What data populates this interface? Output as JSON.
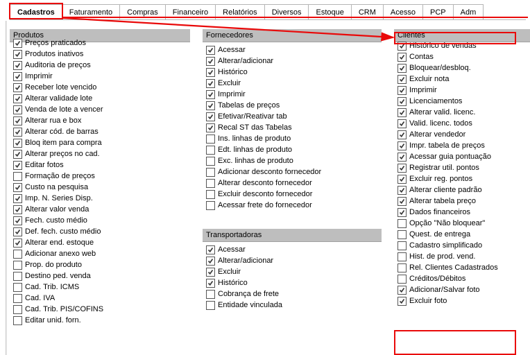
{
  "tabs": {
    "items": [
      {
        "label": "Cadastros",
        "active": true
      },
      {
        "label": "Faturamento",
        "active": false
      },
      {
        "label": "Compras",
        "active": false
      },
      {
        "label": "Financeiro",
        "active": false
      },
      {
        "label": "Relatórios",
        "active": false
      },
      {
        "label": "Diversos",
        "active": false
      },
      {
        "label": "Estoque",
        "active": false
      },
      {
        "label": "CRM",
        "active": false
      },
      {
        "label": "Acesso",
        "active": false
      },
      {
        "label": "PCP",
        "active": false
      },
      {
        "label": "Adm",
        "active": false
      }
    ]
  },
  "sections": {
    "produtos": {
      "title": "Produtos",
      "items": [
        {
          "label": "Preços praticados",
          "checked": true
        },
        {
          "label": "Produtos inativos",
          "checked": true
        },
        {
          "label": "Auditoria de preços",
          "checked": true
        },
        {
          "label": "Imprimir",
          "checked": true
        },
        {
          "label": "Receber lote vencido",
          "checked": true
        },
        {
          "label": "Alterar validade lote",
          "checked": true
        },
        {
          "label": "Venda de lote a vencer",
          "checked": true
        },
        {
          "label": "Alterar rua e box",
          "checked": true
        },
        {
          "label": "Alterar cód. de barras",
          "checked": true
        },
        {
          "label": "Bloq item para compra",
          "checked": true
        },
        {
          "label": "Alterar preços no cad.",
          "checked": true
        },
        {
          "label": "Editar fotos",
          "checked": true
        },
        {
          "label": "Formação de preços",
          "checked": false
        },
        {
          "label": "Custo na pesquisa",
          "checked": true
        },
        {
          "label": "Imp. N. Series Disp.",
          "checked": true
        },
        {
          "label": "Alterar valor venda",
          "checked": true
        },
        {
          "label": "Fech. custo médio",
          "checked": true
        },
        {
          "label": "Def. fech. custo médio",
          "checked": true
        },
        {
          "label": "Alterar end. estoque",
          "checked": true
        },
        {
          "label": "Adicionar anexo web",
          "checked": false
        },
        {
          "label": "Prop. do produto",
          "checked": false
        },
        {
          "label": "Destino ped. venda",
          "checked": false
        },
        {
          "label": "Cad. Trib. ICMS",
          "checked": false
        },
        {
          "label": "Cad. IVA",
          "checked": false
        },
        {
          "label": "Cad. Trib. PIS/COFINS",
          "checked": false
        },
        {
          "label": "Editar unid. forn.",
          "checked": false
        }
      ]
    },
    "fornecedores": {
      "title": "Fornecedores",
      "items": [
        {
          "label": "Acessar",
          "checked": true
        },
        {
          "label": "Alterar/adicionar",
          "checked": true
        },
        {
          "label": "Histórico",
          "checked": true
        },
        {
          "label": "Excluir",
          "checked": true
        },
        {
          "label": "Imprimir",
          "checked": true
        },
        {
          "label": "Tabelas de preços",
          "checked": true
        },
        {
          "label": "Efetivar/Reativar tab",
          "checked": true
        },
        {
          "label": "Recal ST das Tabelas",
          "checked": true
        },
        {
          "label": "Ins. linhas de produto",
          "checked": false
        },
        {
          "label": "Edt. linhas de produto",
          "checked": false
        },
        {
          "label": "Exc. linhas de produto",
          "checked": false
        },
        {
          "label": "Adicionar desconto fornecedor",
          "checked": false
        },
        {
          "label": "Alterar desconto fornecedor",
          "checked": false
        },
        {
          "label": "Excluir desconto fornecedor",
          "checked": false
        },
        {
          "label": "Acessar frete do fornecedor",
          "checked": false
        }
      ]
    },
    "transportadoras": {
      "title": "Transportadoras",
      "items": [
        {
          "label": "Acessar",
          "checked": true
        },
        {
          "label": "Alterar/adicionar",
          "checked": true
        },
        {
          "label": "Excluir",
          "checked": true
        },
        {
          "label": "Histórico",
          "checked": true
        },
        {
          "label": "Cobrança de frete",
          "checked": false
        },
        {
          "label": "Entidade vinculada",
          "checked": false
        }
      ]
    },
    "clientes": {
      "title": "Clientes",
      "items": [
        {
          "label": "Histórico de vendas",
          "checked": true
        },
        {
          "label": "Contas",
          "checked": true
        },
        {
          "label": "Bloquear/desbloq.",
          "checked": true
        },
        {
          "label": "Excluir nota",
          "checked": true
        },
        {
          "label": "Imprimir",
          "checked": true
        },
        {
          "label": "Licenciamentos",
          "checked": true
        },
        {
          "label": "Alterar valid. licenc.",
          "checked": true
        },
        {
          "label": "Valid. licenc. todos",
          "checked": true
        },
        {
          "label": "Alterar vendedor",
          "checked": true
        },
        {
          "label": "Impr. tabela de preços",
          "checked": true
        },
        {
          "label": "Acessar guia pontuação",
          "checked": true
        },
        {
          "label": "Registrar util. pontos",
          "checked": true
        },
        {
          "label": "Excluir reg. pontos",
          "checked": true
        },
        {
          "label": "Alterar cliente padrão",
          "checked": true
        },
        {
          "label": "Alterar tabela preço",
          "checked": true
        },
        {
          "label": "Dados financeiros",
          "checked": true
        },
        {
          "label": "Opção \"Não bloquear\"",
          "checked": false
        },
        {
          "label": "Quest. de entrega",
          "checked": false
        },
        {
          "label": "Cadastro simplificado",
          "checked": false
        },
        {
          "label": "Hist. de prod. vend.",
          "checked": false
        },
        {
          "label": "Rel. Clientes Cadastrados",
          "checked": false
        },
        {
          "label": "Créditos/Débitos",
          "checked": false
        },
        {
          "label": "Adicionar/Salvar foto",
          "checked": true
        },
        {
          "label": "Excluir foto",
          "checked": true
        }
      ]
    }
  }
}
